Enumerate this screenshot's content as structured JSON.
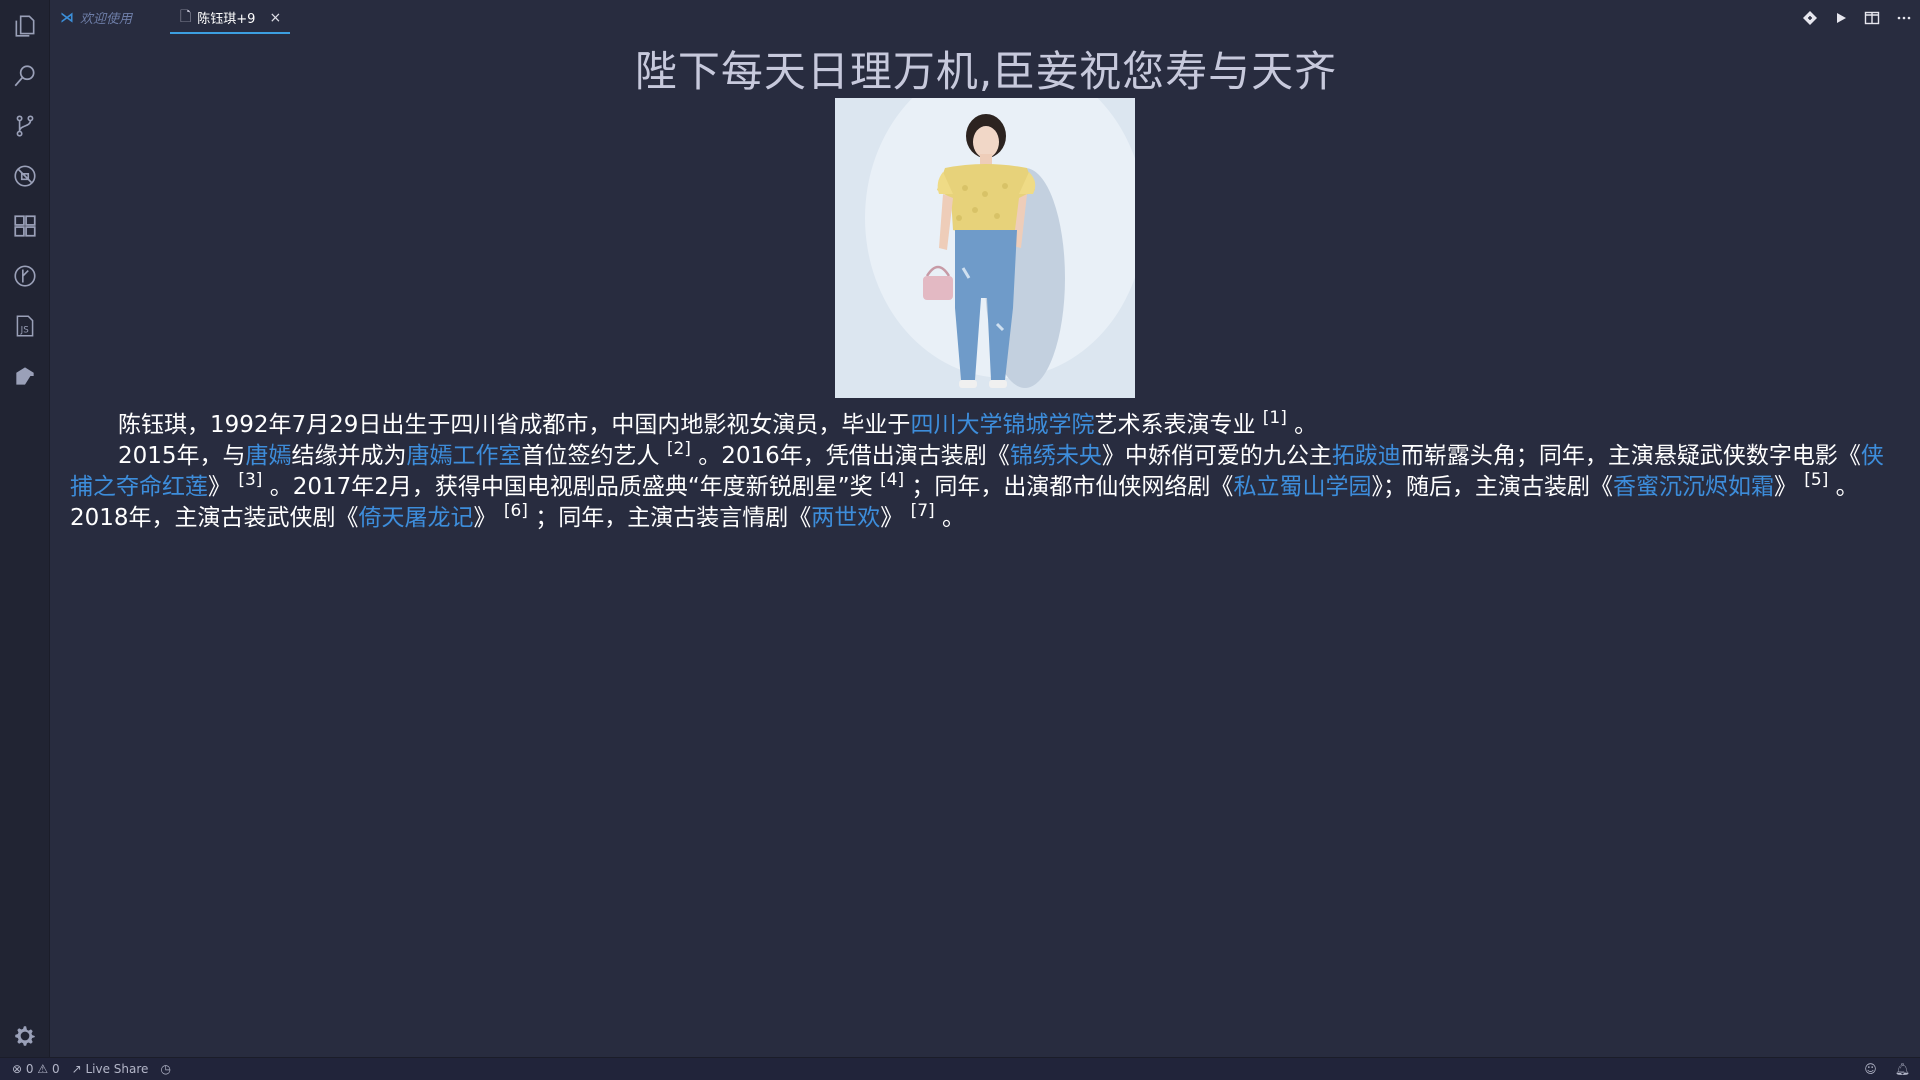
{
  "tabs": {
    "welcome_label": "欢迎使用",
    "active_label": "陈钰琪+9",
    "close_glyph": "×"
  },
  "page": {
    "title": "陛下每天日理万机,臣妾祝您寿与天齐"
  },
  "article": {
    "p1_text1": "陈钰琪，1992年7月29日出生于四川省成都市，中国内地影视女演员，毕业于",
    "p1_link1": "四川大学锦城学院",
    "p1_text2": "艺术系表演专业",
    "p1_ref1": "[1]",
    "p1_end": " 。",
    "p2_text1": "2015年，与",
    "p2_link1": "唐嫣",
    "p2_text2": "结缘并成为",
    "p2_link2": "唐嫣工作室",
    "p2_text3": "首位签约艺人",
    "p2_ref2": "[2]",
    "p2_text4": " 。2016年，凭借出演古装剧《",
    "p2_link3": "锦绣未央",
    "p2_text5": "》中娇俏可爱的九公主",
    "p2_link4": "拓跋迪",
    "p2_text6": "而崭露头角；同年，主演悬疑武侠数字电影《",
    "p2_link5": "侠捕之夺命红莲",
    "p2_text7": "》",
    "p2_ref3": "[3]",
    "p2_text8": " 。2017年2月，获得中国电视剧品质盛典“年度新锐剧星”奖",
    "p2_ref4": "[4]",
    "p2_text9": " ；同年，出演都市仙侠网络剧《",
    "p2_link6": "私立蜀山学园",
    "p2_text10": "》；随后，主演古装剧《",
    "p2_link7": "香蜜沉沉烬如霜",
    "p2_text11": "》",
    "p2_ref5": "[5]",
    "p2_text12": " 。2018年，主演古装武侠剧《",
    "p2_link8": "倚天屠龙记",
    "p2_text13": "》",
    "p2_ref6": "[6]",
    "p2_text14": " ；同年，主演古装言情剧《",
    "p2_link9": "两世欢",
    "p2_text15": "》",
    "p2_ref7": "[7]",
    "p2_end": " 。"
  },
  "statusbar": {
    "errors": "0",
    "warnings": "0",
    "live_share": "Live Share"
  },
  "colors": {
    "background": "#282c3f",
    "activity_bar": "#212433",
    "link": "#3d8ddb",
    "title": "#c7c9dc",
    "tab_underline": "#3c9fe0"
  },
  "icons": {
    "activity": [
      "files-icon",
      "search-icon",
      "source-control-icon",
      "debug-icon",
      "extensions-icon",
      "git-history-icon",
      "js-icon",
      "remote-explorer-icon",
      "gear-icon"
    ],
    "editor_actions": [
      "open-changes-icon",
      "run-icon",
      "split-editor-icon",
      "more-actions-icon"
    ]
  }
}
